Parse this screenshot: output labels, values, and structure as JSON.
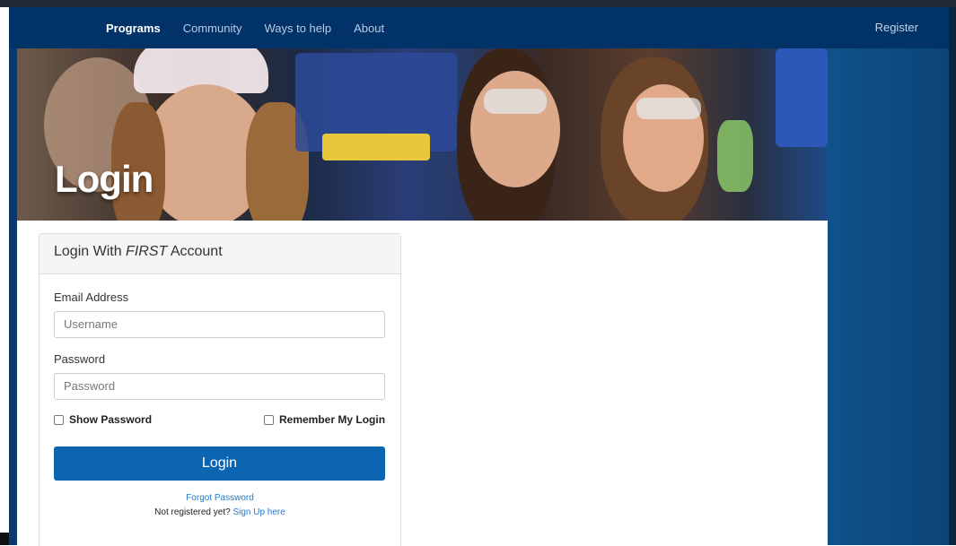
{
  "nav": {
    "items": [
      {
        "label": "Programs",
        "active": true
      },
      {
        "label": "Community",
        "active": false
      },
      {
        "label": "Ways to help",
        "active": false
      },
      {
        "label": "About",
        "active": false
      }
    ],
    "register_label": "Register"
  },
  "hero": {
    "title": "Login"
  },
  "login_panel": {
    "heading_prefix": "Login With ",
    "heading_emphasis": "FIRST",
    "heading_suffix": " Account",
    "email_label": "Email Address",
    "email_placeholder": "Username",
    "password_label": "Password",
    "password_placeholder": "Password",
    "show_password_label": "Show Password",
    "remember_label": "Remember My Login",
    "login_button": "Login",
    "forgot_password": "Forgot Password",
    "not_registered": "Not registered yet? ",
    "signup_link": "Sign Up here"
  },
  "colors": {
    "navbar": "#013369",
    "primary_button": "#0c65b1",
    "link": "#2a78c5"
  }
}
